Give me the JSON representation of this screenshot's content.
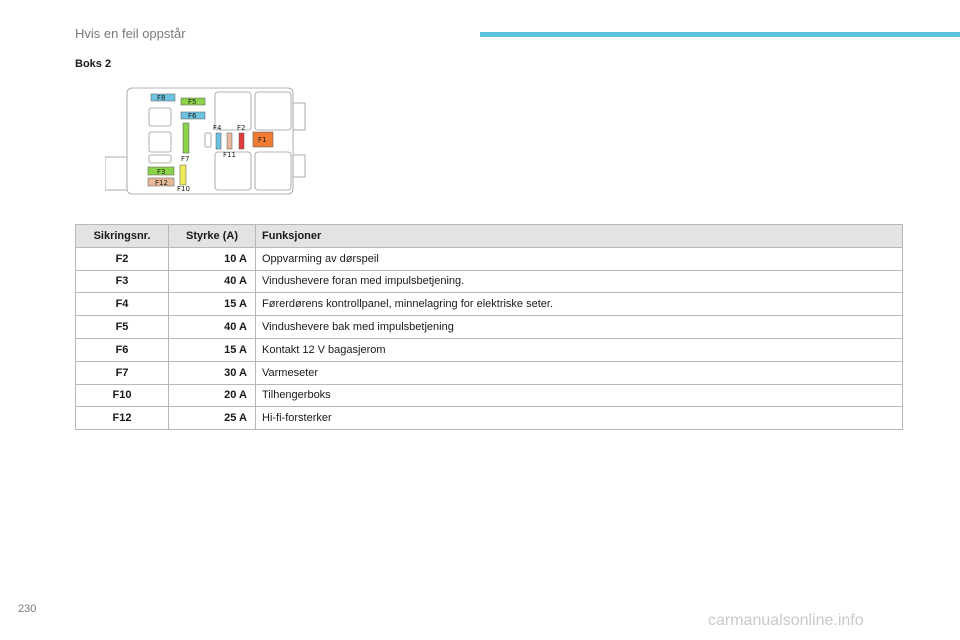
{
  "header": {
    "title": "Hvis en feil oppstår",
    "accent_color": "#5bc3dd"
  },
  "section": {
    "title": "Boks 2"
  },
  "diagram": {
    "labels": {
      "f8": "F8",
      "f5": "F5",
      "f6": "F6",
      "f4": "F4",
      "f2": "F2",
      "f1": "F1",
      "f11": "F11",
      "f7": "F7",
      "f3": "F3",
      "f12": "F12",
      "f10": "F10"
    }
  },
  "table": {
    "headers": {
      "no": "Sikringsnr.",
      "amp": "Styrke (A)",
      "func": "Funksjoner"
    },
    "rows": [
      {
        "no": "F2",
        "amp": "10 A",
        "func": "Oppvarming av dørspeil"
      },
      {
        "no": "F3",
        "amp": "40 A",
        "func": "Vindushevere foran med impulsbetjening."
      },
      {
        "no": "F4",
        "amp": "15 A",
        "func": "Førerdørens kontrollpanel, minnelagring for elektriske seter."
      },
      {
        "no": "F5",
        "amp": "40 A",
        "func": "Vindushevere bak med impulsbetjening"
      },
      {
        "no": "F6",
        "amp": "15 A",
        "func": "Kontakt 12 V bagasjerom"
      },
      {
        "no": "F7",
        "amp": "30 A",
        "func": "Varmeseter"
      },
      {
        "no": "F10",
        "amp": "20 A",
        "func": "Tilhengerboks"
      },
      {
        "no": "F12",
        "amp": "25 A",
        "func": "Hi-fi-forsterker"
      }
    ]
  },
  "footer": {
    "page_number": "230",
    "watermark": "carmanualsonline.info"
  }
}
